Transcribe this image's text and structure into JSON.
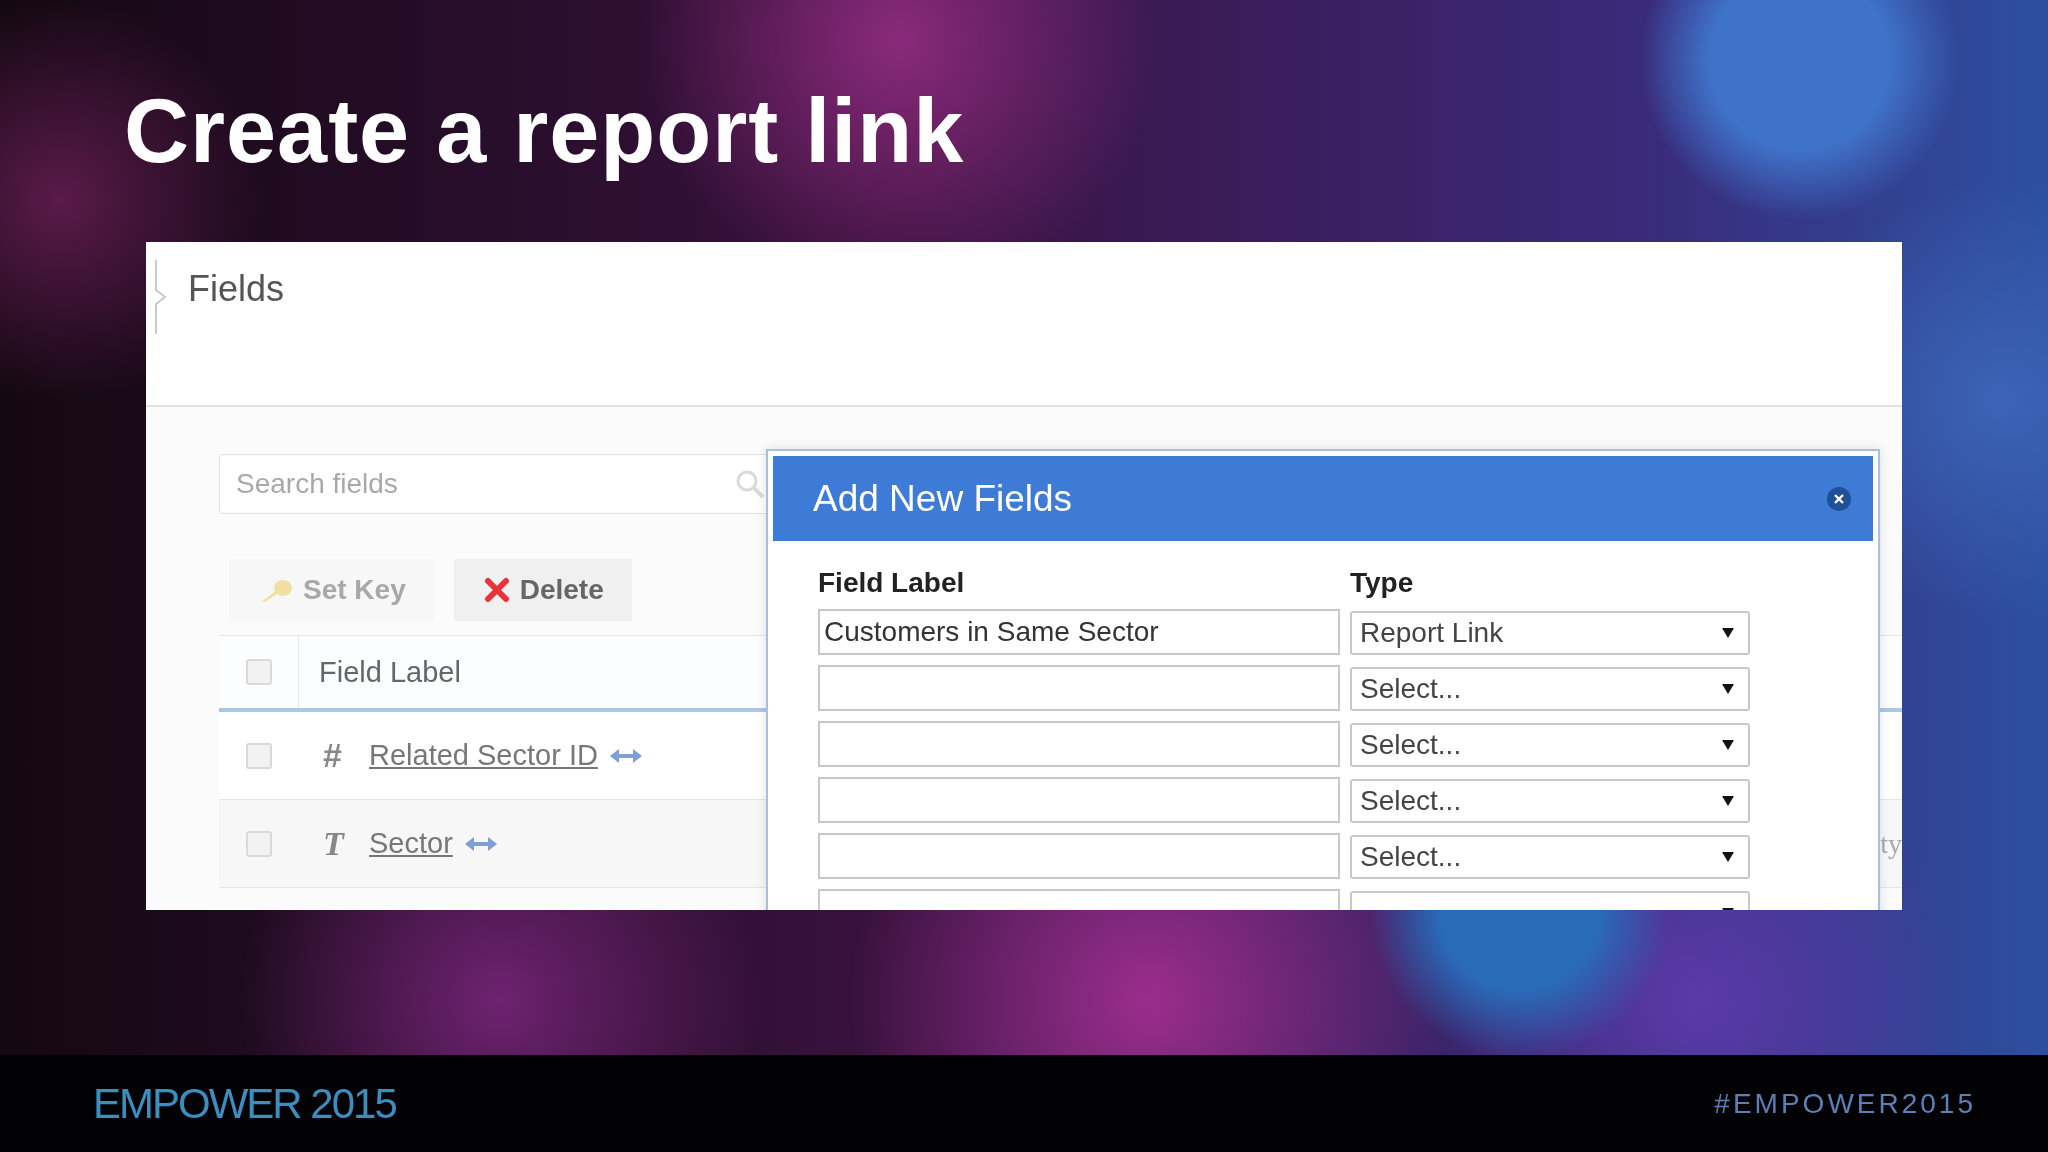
{
  "slide": {
    "title": "Create a report link"
  },
  "app": {
    "section_title": "Fields",
    "search": {
      "placeholder": "Search fields"
    },
    "toolbar": [
      {
        "label": "Set Key",
        "kind": "key",
        "disabled": true
      },
      {
        "label": "Delete",
        "kind": "delete",
        "disabled": false
      }
    ],
    "table": {
      "columns": [
        "Field Label"
      ],
      "header_checked": false,
      "rows": [
        {
          "type_glyph": "#",
          "label": "Related Sector ID",
          "checked": false,
          "linked": true
        },
        {
          "type_glyph": "T",
          "label": "Sector",
          "checked": false,
          "linked": true,
          "column_3": "ty"
        }
      ]
    }
  },
  "dialog": {
    "title": "Add New Fields",
    "columns": [
      "Field Label",
      "Type"
    ],
    "rows": [
      {
        "label": "Customers in Same Sector",
        "type": "Report Link"
      },
      {
        "type": "Select..."
      },
      {
        "type": "Select..."
      },
      {
        "type": "Select..."
      },
      {
        "type": "Select..."
      }
    ],
    "more_rows_below": true
  },
  "footer": {
    "event": "EMPOWER 2015",
    "hashtag": "#EMPOWER2015"
  }
}
